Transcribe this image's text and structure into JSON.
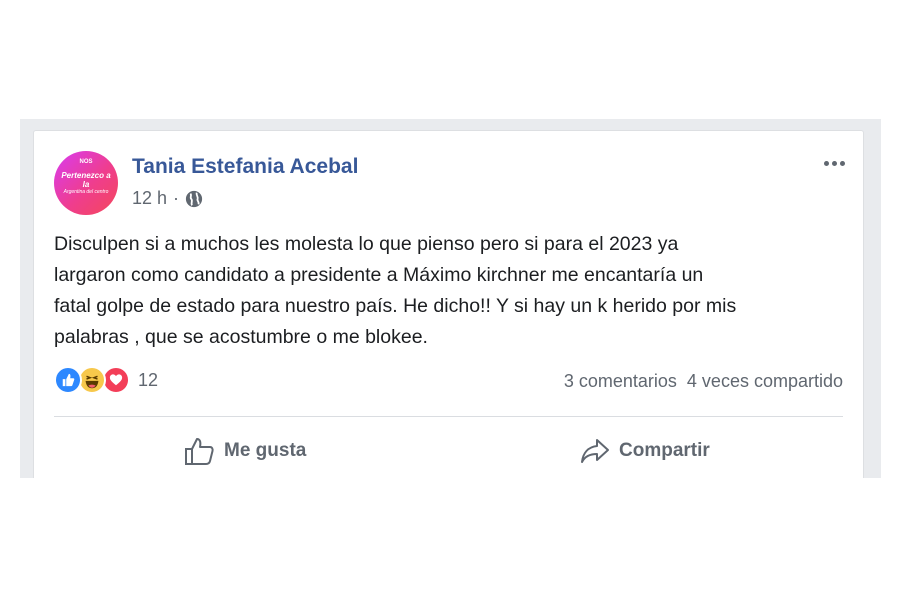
{
  "post": {
    "author": {
      "name": "Tania Estefania Acebal",
      "avatar_text": {
        "top": "NOS",
        "main": "Pertenezco a la",
        "sub": "Argentina del centro"
      }
    },
    "time": "12 h",
    "privacy_icon": "globe-icon",
    "text_lines": [
      "Disculpen si a muchos les molesta lo que pienso pero si para el 2023 ya",
      "largaron como candidato a presidente a Máximo kirchner me encantaría un",
      "fatal golpe de estado para nuestro país. He dicho!! Y si hay un k herido por mis",
      "palabras , que se acostumbre o me blokee."
    ],
    "reactions": {
      "icons": [
        "like-reaction-icon",
        "haha-reaction-icon",
        "love-reaction-icon"
      ],
      "count": "12"
    },
    "comments": "3 comentarios",
    "shares": "4 veces compartido"
  },
  "actions": {
    "like_label": "Me gusta",
    "share_label": "Compartir"
  },
  "colors": {
    "name_link": "#385898",
    "secondary_text": "#606770",
    "like_blue": "#2d88ff",
    "love_red": "#f33e58",
    "haha_yellow": "#f7c84b"
  }
}
